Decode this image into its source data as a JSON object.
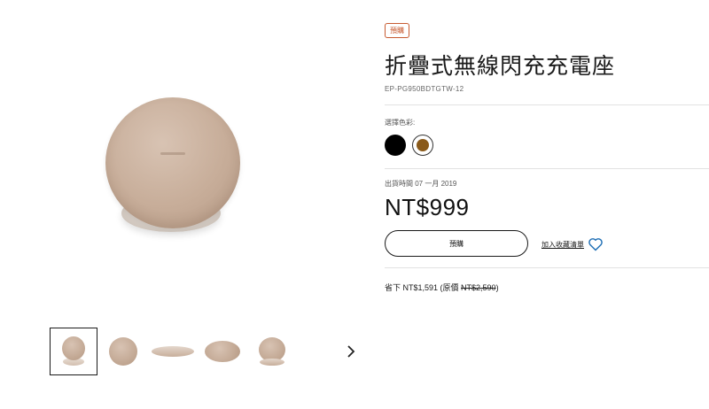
{
  "product": {
    "badge": "預購",
    "title": "折疊式無線閃充充電座",
    "sku": "EP-PG950BDTGTW-12"
  },
  "color_selector": {
    "label": "選擇色彩:",
    "swatches": [
      {
        "name": "black",
        "color": "#000000",
        "selected": false
      },
      {
        "name": "gold",
        "color": "#8a5a1a",
        "selected": true
      }
    ]
  },
  "shipping": {
    "label": "出貨時間 07 一月 2019"
  },
  "pricing": {
    "price": "NT$999",
    "savings_prefix": "省下 NT$1,591 (原價 ",
    "original_price": "NT$2,590",
    "savings_suffix": ")"
  },
  "actions": {
    "preorder_label": "預購",
    "wishlist_label": "加入收藏清單"
  },
  "gallery": {
    "thumbnail_count": 5,
    "selected_index": 0
  },
  "colors": {
    "badge": "#c75b31",
    "wishlist_heart": "#1f6fb5",
    "product_tan": "#c7ad99"
  },
  "icons": {
    "next": "chevron-right-icon",
    "wishlist": "heart-icon"
  }
}
